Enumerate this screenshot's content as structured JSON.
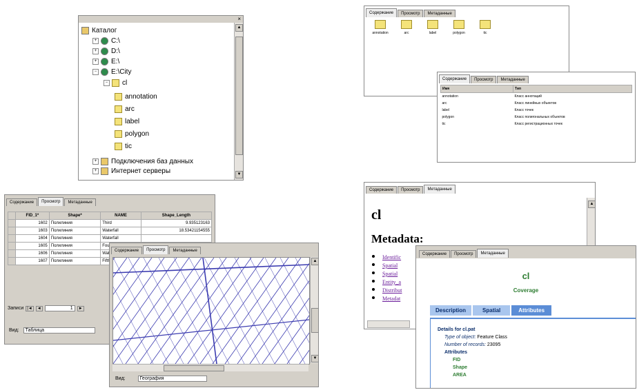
{
  "catalog": {
    "items": [
      {
        "label": "Каталог",
        "icon": "catalog-icon"
      },
      {
        "label": "C:\\",
        "icon": "drive-icon"
      },
      {
        "label": "D:\\",
        "icon": "drive-icon"
      },
      {
        "label": "E:\\",
        "icon": "drive-icon"
      },
      {
        "label": "E:\\City",
        "icon": "folder-icon"
      },
      {
        "label": "cl",
        "icon": "coverage-icon"
      },
      {
        "label": "annotation",
        "icon": "annotation-icon"
      },
      {
        "label": "arc",
        "icon": "arc-icon"
      },
      {
        "label": "label",
        "icon": "label-icon"
      },
      {
        "label": "polygon",
        "icon": "polygon-icon"
      },
      {
        "label": "tic",
        "icon": "tic-icon"
      },
      {
        "label": "Подключения баз данных",
        "icon": "database-icon"
      },
      {
        "label": "Интернет серверы",
        "icon": "server-icon"
      }
    ]
  },
  "tabs": {
    "contents": "Содержание",
    "preview": "Просмотр",
    "metadata": "Метаданные"
  },
  "contents_icons": [
    "annotation",
    "arc",
    "label",
    "polygon",
    "tic"
  ],
  "contents_list": {
    "headers": [
      "Имя",
      "Тип"
    ],
    "rows": [
      [
        "annotation",
        "Класс аннотаций"
      ],
      [
        "arc",
        "Класс линейных объектов"
      ],
      [
        "label",
        "Класс точек"
      ],
      [
        "polygon",
        "Класс полигональных объектов"
      ],
      [
        "tic",
        "Класс регистрационных точек"
      ]
    ]
  },
  "table_preview": {
    "headers": [
      "FID_1*",
      "Shape*",
      "NAME",
      "Shape_Length"
    ],
    "rows": [
      [
        "1602",
        "Полилиния",
        "Third",
        "9.935123163"
      ],
      [
        "1603",
        "Полилиния",
        "Waterfall",
        "18.53421154555"
      ],
      [
        "1604",
        "Полилиния",
        "Waterfall",
        ""
      ],
      [
        "1605",
        "Полилиния",
        "Fourth",
        ""
      ],
      [
        "1606",
        "Полилиния",
        "Waterfall",
        ""
      ],
      [
        "1607",
        "Полилиния",
        "Fifth",
        ""
      ]
    ],
    "record_label": "Записи",
    "record_value": "1",
    "view_label": "Вид:",
    "view_value": "Таблица"
  },
  "geo_preview": {
    "view_label": "Вид:",
    "view_value": "География"
  },
  "metadata_doc": {
    "title": "cl",
    "subtitle": "Metadata:",
    "links": [
      "Identific",
      "Spatial",
      "Spatial",
      "Entity_a",
      "Distribut",
      "Metadat"
    ]
  },
  "metadata_card": {
    "title": "cl",
    "subtitle": "Coverage",
    "tabs": [
      "Description",
      "Spatial",
      "Attributes"
    ],
    "details_title": "Details for cl.pat",
    "type_label": "Type of object:",
    "type_value": "Feature Class",
    "records_label": "Number of records:",
    "records_value": "23095",
    "attributes_title": "Attributes",
    "attributes": [
      "FID",
      "Shape",
      "AREA"
    ]
  },
  "colors": {
    "tab_blue": "#5b8dd6",
    "attr_green": "#2e7d32",
    "link_purple": "#6a1b9a",
    "map_line": "#3b3bb0"
  }
}
